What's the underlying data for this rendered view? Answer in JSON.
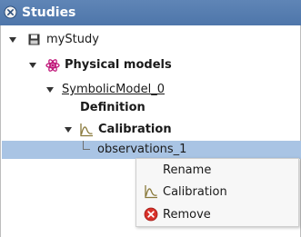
{
  "window": {
    "title": "Studies"
  },
  "tree": {
    "study": "myStudy",
    "physical_models": "Physical models",
    "model": "SymbolicModel_0",
    "definition": "Definition",
    "calibration": "Calibration",
    "observations": "observations_1"
  },
  "context_menu": {
    "items": [
      {
        "label": "Rename",
        "icon": "none"
      },
      {
        "label": "Calibration",
        "icon": "calibration-icon"
      },
      {
        "label": "Remove",
        "icon": "remove-icon"
      }
    ]
  },
  "colors": {
    "title_bar": "#5279ad",
    "selection": "#a9c4e4",
    "physics_icon": "#c0187a",
    "calibration_icon": "#8a7a3c",
    "remove_icon": "#d8312a"
  }
}
